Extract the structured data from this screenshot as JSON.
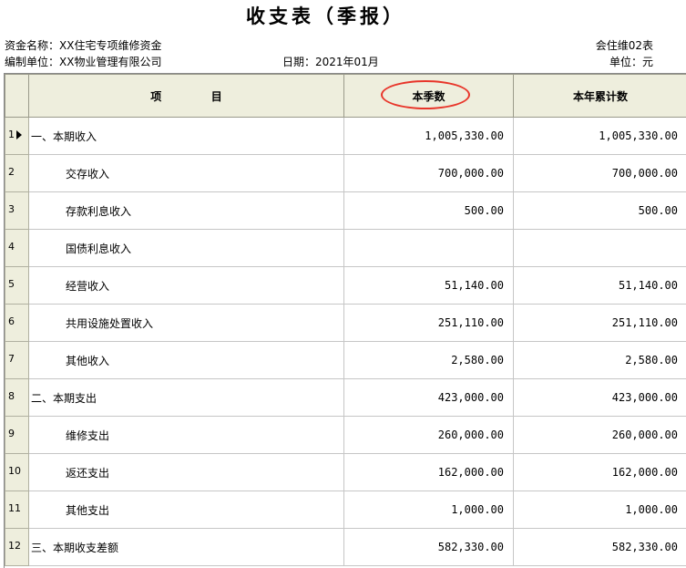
{
  "title": "收支表（季报）",
  "fund_name": "资金名称：XX住宅专项维修资金",
  "report_code": "会住维02表",
  "compiler": "编制单位：XX物业管理有限公司",
  "date": "日期：2021年01月",
  "unit": "单位：元",
  "columns": {
    "item_a": "项",
    "item_b": "目",
    "current_quarter": "本季数",
    "year_to_date": "本年累计数"
  },
  "accent_color": "#e8352a",
  "rows": [
    {
      "n": "1",
      "item": "一、本期收入",
      "q": "1,005,330.00",
      "y": "1,005,330.00"
    },
    {
      "n": "2",
      "item": "交存收入",
      "q": "700,000.00",
      "y": "700,000.00"
    },
    {
      "n": "3",
      "item": "存款利息收入",
      "q": "500.00",
      "y": "500.00"
    },
    {
      "n": "4",
      "item": "国债利息收入",
      "q": "",
      "y": ""
    },
    {
      "n": "5",
      "item": "经营收入",
      "q": "51,140.00",
      "y": "51,140.00"
    },
    {
      "n": "6",
      "item": "共用设施处置收入",
      "q": "251,110.00",
      "y": "251,110.00"
    },
    {
      "n": "7",
      "item": "其他收入",
      "q": "2,580.00",
      "y": "2,580.00"
    },
    {
      "n": "8",
      "item": "二、本期支出",
      "q": "423,000.00",
      "y": "423,000.00"
    },
    {
      "n": "9",
      "item": "维修支出",
      "q": "260,000.00",
      "y": "260,000.00"
    },
    {
      "n": "10",
      "item": "返还支出",
      "q": "162,000.00",
      "y": "162,000.00"
    },
    {
      "n": "11",
      "item": "其他支出",
      "q": "1,000.00",
      "y": "1,000.00"
    },
    {
      "n": "12",
      "item": "三、本期收支差额",
      "q": "582,330.00",
      "y": "582,330.00"
    }
  ]
}
